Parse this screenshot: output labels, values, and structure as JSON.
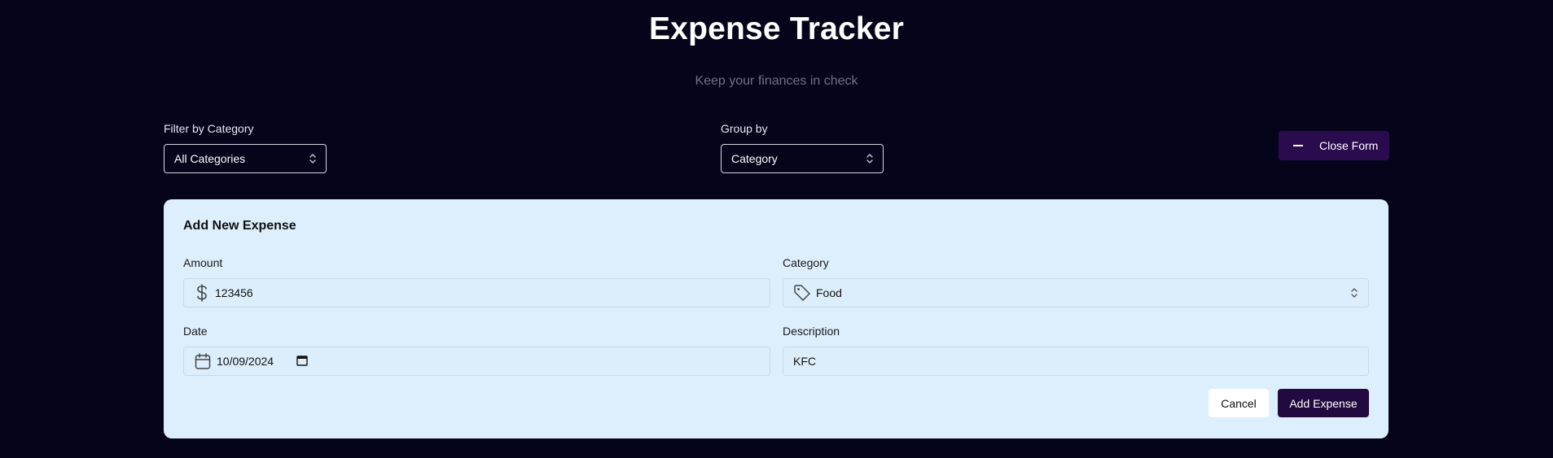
{
  "header": {
    "title": "Expense Tracker",
    "subtitle": "Keep your finances in check"
  },
  "filters": {
    "category_label": "Filter by Category",
    "category_value": "All Categories",
    "group_label": "Group by",
    "group_value": "Category"
  },
  "toggle_form": {
    "label": "Close Form",
    "icon": "minus-icon"
  },
  "form": {
    "title": "Add New Expense",
    "amount_label": "Amount",
    "amount_value": "123456",
    "amount_icon": "dollar-icon",
    "category_label": "Category",
    "category_value": "Food",
    "category_icon": "tag-icon",
    "date_label": "Date",
    "date_value": "10/09/2024",
    "date_icon": "calendar-icon",
    "description_label": "Description",
    "description_value": "KFC",
    "cancel_label": "Cancel",
    "submit_label": "Add Expense"
  },
  "colors": {
    "background": "#05041a",
    "accent": "#22093f",
    "card": "#ddeefc"
  }
}
